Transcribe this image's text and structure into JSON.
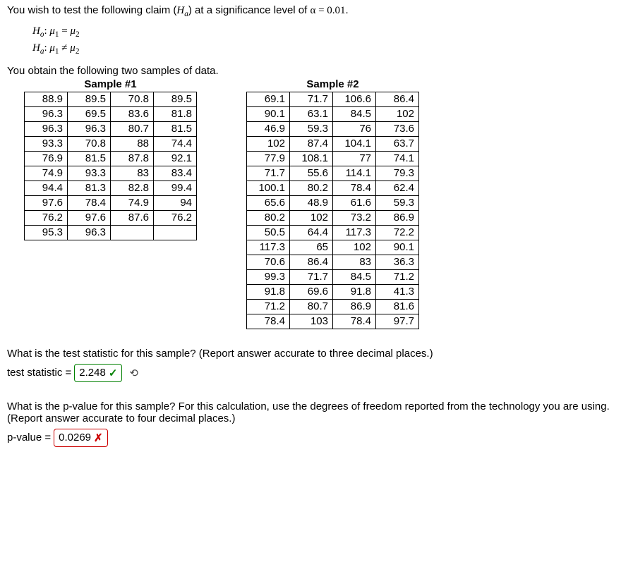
{
  "intro": {
    "line1_pre": "You wish to test the following claim (",
    "line1_post": ") at a significance level of ",
    "alpha_expr": "α = 0.01",
    "period": ".",
    "Ha_sym": "H",
    "Ha_sub": "a"
  },
  "hyp": {
    "H_sym": "H",
    "o_sub": "o",
    "a_sub": "a",
    "mu": "μ",
    "one": "1",
    "two": "2",
    "eq": " = ",
    "neq": " ≠ ",
    "colon": ": "
  },
  "samples_intro": "You obtain the following two samples of data.",
  "sample1": {
    "title": "Sample #1",
    "rows": [
      [
        "88.9",
        "89.5",
        "70.8",
        "89.5"
      ],
      [
        "96.3",
        "69.5",
        "83.6",
        "81.8"
      ],
      [
        "96.3",
        "96.3",
        "80.7",
        "81.5"
      ],
      [
        "93.3",
        "70.8",
        "88",
        "74.4"
      ],
      [
        "76.9",
        "81.5",
        "87.8",
        "92.1"
      ],
      [
        "74.9",
        "93.3",
        "83",
        "83.4"
      ],
      [
        "94.4",
        "81.3",
        "82.8",
        "99.4"
      ],
      [
        "97.6",
        "78.4",
        "74.9",
        "94"
      ],
      [
        "76.2",
        "97.6",
        "87.6",
        "76.2"
      ],
      [
        "95.3",
        "96.3",
        "",
        ""
      ]
    ]
  },
  "sample2": {
    "title": "Sample #2",
    "rows": [
      [
        "69.1",
        "71.7",
        "106.6",
        "86.4"
      ],
      [
        "90.1",
        "63.1",
        "84.5",
        "102"
      ],
      [
        "46.9",
        "59.3",
        "76",
        "73.6"
      ],
      [
        "102",
        "87.4",
        "104.1",
        "63.7"
      ],
      [
        "77.9",
        "108.1",
        "77",
        "74.1"
      ],
      [
        "71.7",
        "55.6",
        "114.1",
        "79.3"
      ],
      [
        "100.1",
        "80.2",
        "78.4",
        "62.4"
      ],
      [
        "65.6",
        "48.9",
        "61.6",
        "59.3"
      ],
      [
        "80.2",
        "102",
        "73.2",
        "86.9"
      ],
      [
        "50.5",
        "64.4",
        "117.3",
        "72.2"
      ],
      [
        "117.3",
        "65",
        "102",
        "90.1"
      ],
      [
        "70.6",
        "86.4",
        "83",
        "36.3"
      ],
      [
        "99.3",
        "71.7",
        "84.5",
        "71.2"
      ],
      [
        "91.8",
        "69.6",
        "91.8",
        "41.3"
      ],
      [
        "71.2",
        "80.7",
        "86.9",
        "81.6"
      ],
      [
        "78.4",
        "103",
        "78.4",
        "97.7"
      ]
    ]
  },
  "q1": {
    "prompt": "What is the test statistic for this sample? (Report answer accurate to three decimal places.)",
    "label": "test statistic = ",
    "value": "2.248",
    "check": "✓"
  },
  "q2": {
    "prompt": "What is the p-value for this sample? For this calculation, use the degrees of freedom reported from the technology you are using. (Report answer accurate to four decimal places.)",
    "label": "p-value = ",
    "value": "0.0269",
    "cross": "✗"
  },
  "retry_glyph": "⟲"
}
